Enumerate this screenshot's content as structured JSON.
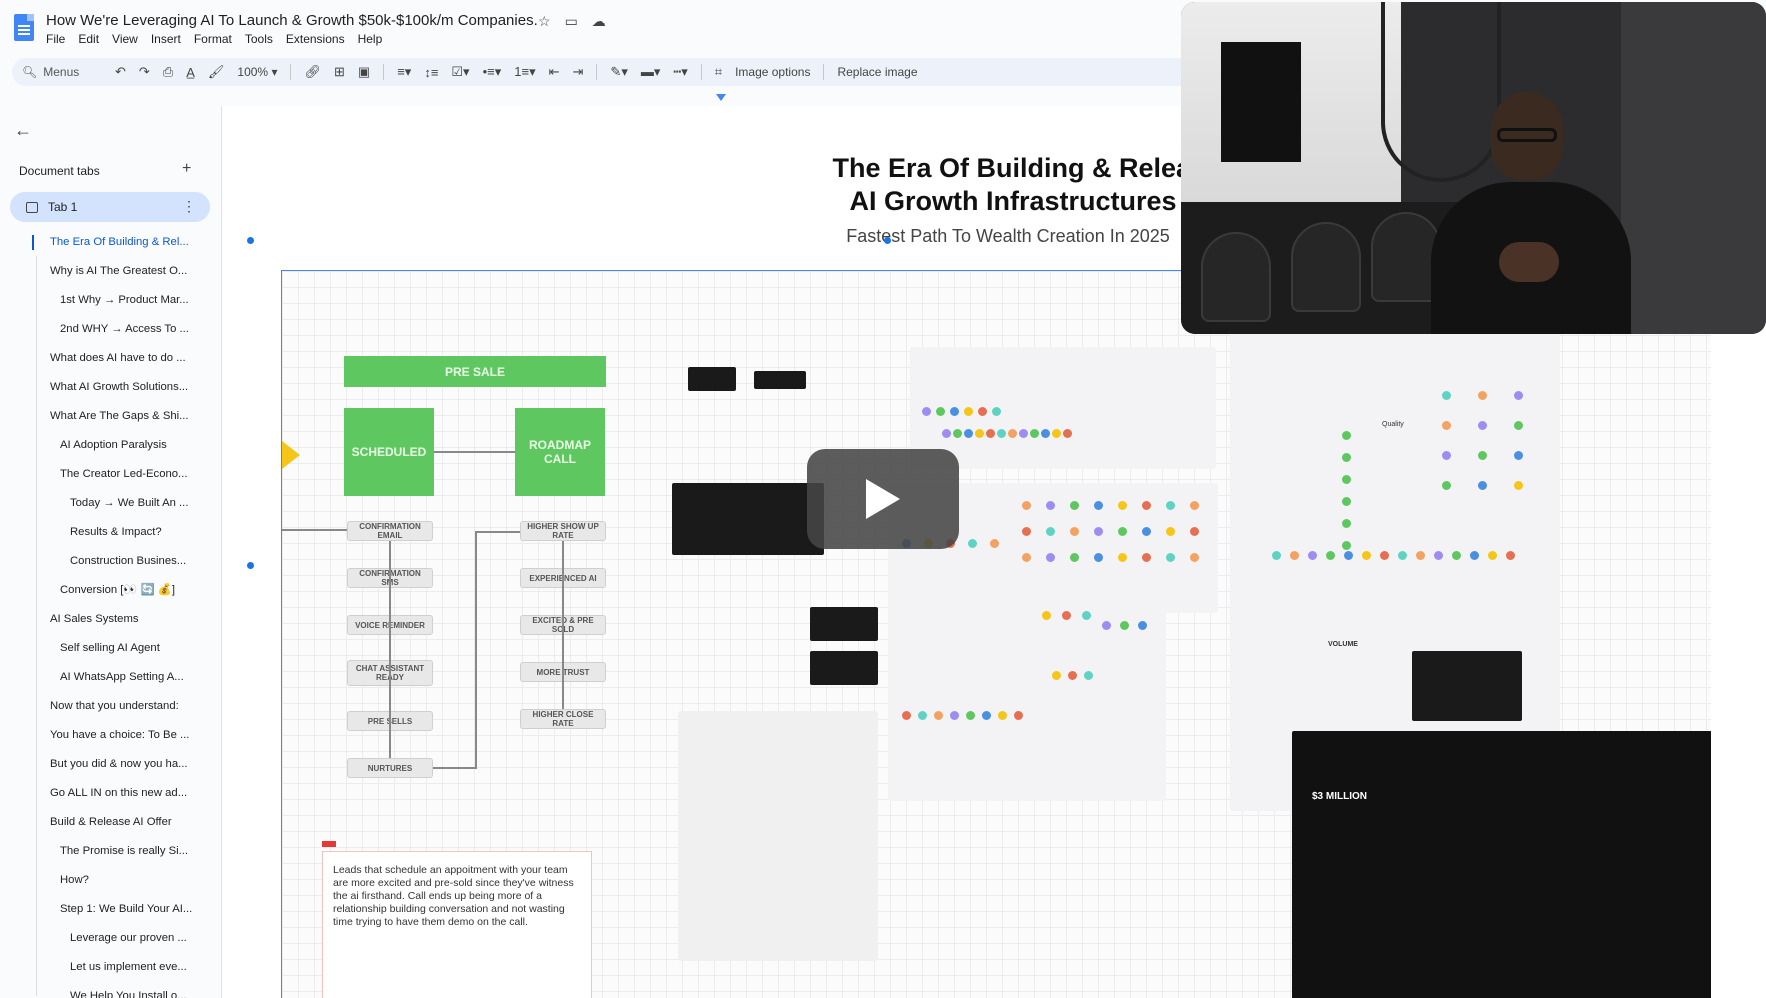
{
  "doc": {
    "title": "How We're Leveraging AI To Launch & Growth $50k-$100k/m Companies.",
    "menus": [
      "File",
      "Edit",
      "View",
      "Insert",
      "Format",
      "Tools",
      "Extensions",
      "Help"
    ]
  },
  "toolbar": {
    "search_label": "Menus",
    "zoom": "100%",
    "image_options": "Image options",
    "replace_image": "Replace image"
  },
  "sidebar": {
    "heading": "Document tabs",
    "tab_label": "Tab 1",
    "outline": [
      {
        "text": "The Era Of Building & Rel...",
        "level": 1,
        "active": true
      },
      {
        "text": "Why is AI The Greatest O...",
        "level": 1
      },
      {
        "text": "1st Why → Product Mar...",
        "level": 2
      },
      {
        "text": "2nd WHY → Access To ...",
        "level": 2
      },
      {
        "text": "What does AI have to do ...",
        "level": 1
      },
      {
        "text": "What AI Growth Solutions...",
        "level": 1
      },
      {
        "text": "What Are The Gaps & Shi...",
        "level": 1
      },
      {
        "text": "AI Adoption Paralysis",
        "level": 2
      },
      {
        "text": "The Creator Led-Econo...",
        "level": 2
      },
      {
        "text": "Today → We Built An ...",
        "level": 3
      },
      {
        "text": "Results & Impact?",
        "level": 3
      },
      {
        "text": "Construction Busines...",
        "level": 3
      },
      {
        "text": "Conversion [👀 🔄 💰]",
        "level": 2
      },
      {
        "text": "AI Sales Systems",
        "level": 1
      },
      {
        "text": "Self selling AI Agent",
        "level": 2
      },
      {
        "text": "AI WhatsApp Setting A...",
        "level": 2
      },
      {
        "text": "Now that you understand:",
        "level": 1
      },
      {
        "text": "You have a choice: To Be ...",
        "level": 1
      },
      {
        "text": "But you did & now you ha...",
        "level": 1
      },
      {
        "text": "Go ALL IN on this new ad...",
        "level": 1
      },
      {
        "text": "Build & Release AI Offer",
        "level": 1
      },
      {
        "text": "The Promise is really Si...",
        "level": 2
      },
      {
        "text": "How?",
        "level": 2
      },
      {
        "text": "Step 1: We Build Your AI...",
        "level": 2
      },
      {
        "text": "Leverage our proven ...",
        "level": 3
      },
      {
        "text": "Let us implement eve...",
        "level": 3
      },
      {
        "text": "We Help You Install o...",
        "level": 3
      }
    ]
  },
  "page": {
    "heading_line1": "The Era Of Building & Releasi",
    "heading_line2": "AI Growth Infrastructures",
    "subheading": "Fastest Path To Wealth Creation In 2025"
  },
  "board": {
    "pre_sale": "PRE SALE",
    "scheduled": "SCHEDULED",
    "roadmap_call": "ROADMAP CALL",
    "left_steps": [
      "CONFIRMATION EMAIL",
      "CONFIRMATION SMS",
      "VOICE REMINDER",
      "CHAT ASSISTANT READY",
      "PRE SELLS",
      "NURTURES"
    ],
    "right_steps": [
      "HIGHER SHOW UP RATE",
      "EXPERIENCED AI",
      "EXCITED & PRE SOLD",
      "MORE TRUST",
      "HIGHER CLOSE RATE"
    ],
    "note": "Leads that schedule an appoitment with your team are more excited and pre-sold since they've witness the ai firsthand. Call ends up being more of a relationship building conversation and not wasting time trying to have them demo on the call.",
    "volume_label": "VOLUME",
    "quality_label": "Quality",
    "million_badge": "$3 MILLION"
  },
  "colors": {
    "green": "#5ec760",
    "accent_blue": "#0b57d0",
    "tab_bg": "#d3e3fd"
  }
}
